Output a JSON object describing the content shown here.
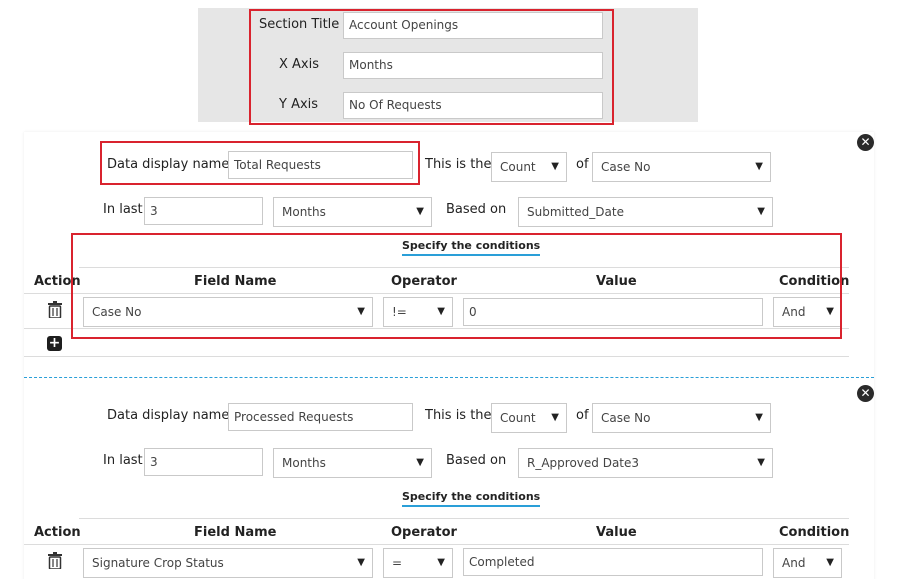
{
  "chart_settings": {
    "section_title_label": "Section Title",
    "section_title_value": "Account Openings",
    "x_axis_label": "X Axis",
    "x_axis_value": "Months",
    "y_axis_label": "Y Axis",
    "y_axis_value": "No Of Requests"
  },
  "blocks": [
    {
      "data_display_name_label": "Data display name",
      "data_display_name_value": "Total Requests",
      "this_is_the_label": "This is the",
      "aggregate": "Count",
      "of_label": "of",
      "of_field": "Case No",
      "in_last_label": "In last",
      "in_last_value": "3",
      "period": "Months",
      "based_on_label": "Based on",
      "based_on_field": "Submitted_Date",
      "specify_conditions": "Specify the conditions",
      "headers": {
        "action": "Action",
        "field_name": "Field Name",
        "operator": "Operator",
        "value": "Value",
        "condition": "Condition"
      },
      "rows": [
        {
          "field": "Case No",
          "operator": "!=",
          "value": "0",
          "condition": "And"
        }
      ]
    },
    {
      "data_display_name_label": "Data display name",
      "data_display_name_value": "Processed Requests",
      "this_is_the_label": "This is the",
      "aggregate": "Count",
      "of_label": "of",
      "of_field": "Case No",
      "in_last_label": "In last",
      "in_last_value": "3",
      "period": "Months",
      "based_on_label": "Based on",
      "based_on_field": "R_Approved Date3",
      "specify_conditions": "Specify the conditions",
      "headers": {
        "action": "Action",
        "field_name": "Field Name",
        "operator": "Operator",
        "value": "Value",
        "condition": "Condition"
      },
      "rows": [
        {
          "field": "Signature Crop Status",
          "operator": "=",
          "value": "Completed",
          "condition": "And"
        }
      ]
    }
  ],
  "icons": {
    "close": "close-icon",
    "delete": "trash-icon",
    "add": "plus-icon",
    "dropdown": "chevron-down-icon"
  },
  "colors": {
    "highlight": "#d9232e",
    "accent": "#2a9fd8",
    "panel": "#e6e6e6"
  }
}
